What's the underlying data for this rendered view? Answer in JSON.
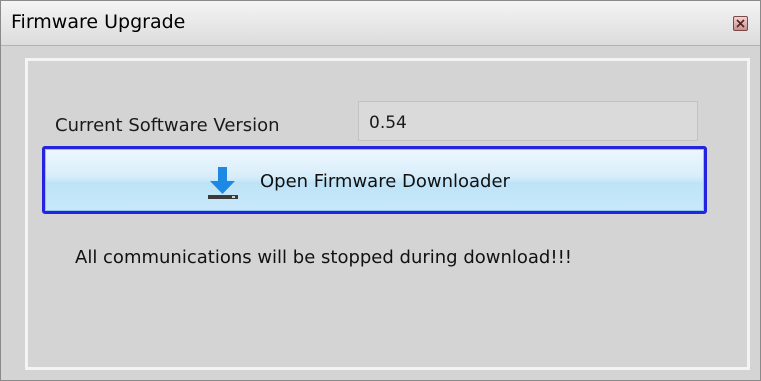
{
  "window": {
    "title": "Firmware Upgrade",
    "close_icon": "close-icon"
  },
  "version": {
    "label": "Current Software Version",
    "value": "0.54"
  },
  "downloader_button": {
    "label": "Open Firmware Downloader",
    "icon": "download-icon"
  },
  "warning": {
    "text": "All communications will be stopped during download!!!"
  },
  "colors": {
    "button_border": "#2424e0",
    "button_gradient_top": "#eef7fd",
    "button_gradient_bottom": "#bee3f7",
    "icon_blue": "#1e88e5",
    "window_bg": "#d4d4d4"
  }
}
